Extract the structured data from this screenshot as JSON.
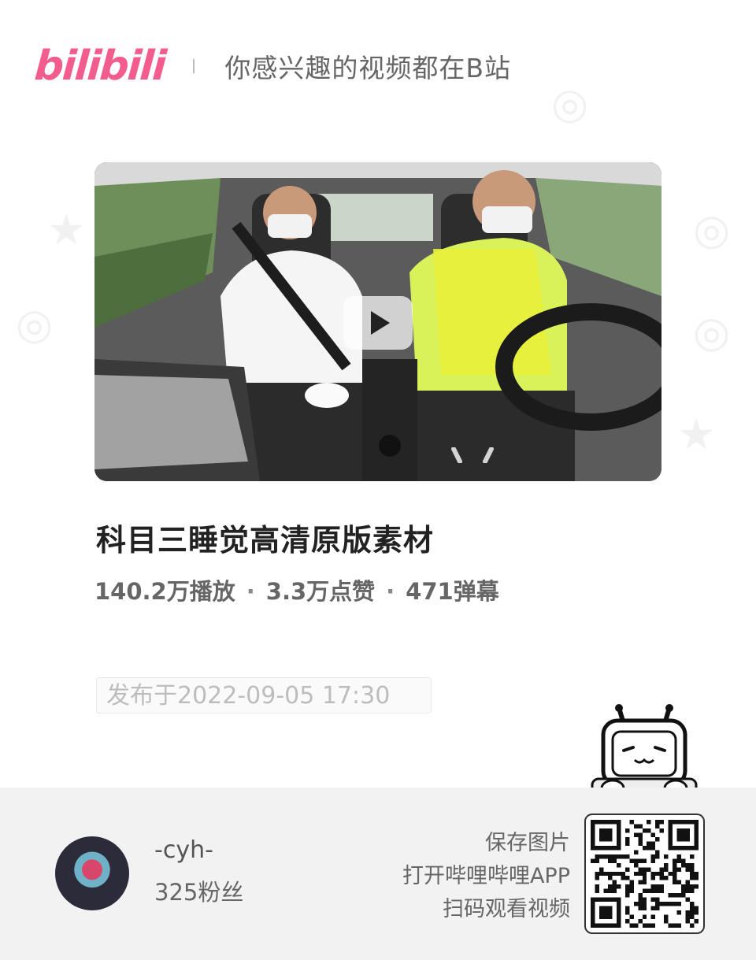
{
  "header": {
    "logo_text": "bilibili",
    "slogan": "你感兴趣的视频都在B站"
  },
  "video": {
    "title": "科目三睡觉高清原版素材",
    "stats": {
      "plays": "140.2万播放",
      "likes": "3.3万点赞",
      "danmaku": "471弹幕",
      "separator": "·"
    },
    "publish_time": "发布于2022-09-05 17:30"
  },
  "uploader": {
    "name": "-cyh-",
    "fans": "325粉丝"
  },
  "share_hint": {
    "line1": "保存图片",
    "line2": "打开哔哩哔哩APP",
    "line3": "扫码观看视频"
  },
  "colors": {
    "brand": "#f25d8e",
    "footer_bg": "#f2f2f2",
    "text_muted": "#666666"
  },
  "icons": {
    "play": "play-icon",
    "mascot": "tv-mascot-icon",
    "qr": "qr-code"
  }
}
